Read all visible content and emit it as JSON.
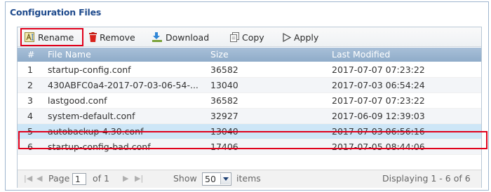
{
  "section": {
    "title": "Configuration Files"
  },
  "toolbar": {
    "rename": "Rename",
    "remove": "Remove",
    "download": "Download",
    "copy": "Copy",
    "apply": "Apply"
  },
  "columns": {
    "num": "#",
    "name": "File Name",
    "size": "Size",
    "modified": "Last Modified"
  },
  "rows": [
    {
      "num": "1",
      "name": "startup-config.conf",
      "size": "36582",
      "modified": "2017-07-07 07:23:22"
    },
    {
      "num": "2",
      "name": "430ABFC0a4-2017-07-03-06-54-...",
      "size": "13040",
      "modified": "2017-07-03 06:54:24"
    },
    {
      "num": "3",
      "name": "lastgood.conf",
      "size": "36582",
      "modified": "2017-07-07 07:23:22"
    },
    {
      "num": "4",
      "name": "system-default.conf",
      "size": "32927",
      "modified": "2017-06-09 12:39:03"
    },
    {
      "num": "5",
      "name": "autobackup-4.30.conf",
      "size": "13040",
      "modified": "2017-07-03 06:56:16"
    },
    {
      "num": "6",
      "name": "startup-config-bad.conf",
      "size": "17406",
      "modified": "2017-07-05 08:44:06"
    }
  ],
  "pager": {
    "page_label": "Page",
    "page_value": "1",
    "of_label": "of 1",
    "show_label": "Show",
    "page_size": "50",
    "items_label": "items",
    "displaying": "Displaying 1 - 6 of 6"
  },
  "colors": {
    "title": "#1e4a8c",
    "header": "#9bb6d2",
    "selected_row": "#cde6f7",
    "highlight": "#e0001b",
    "remove_icon": "#d9221c"
  },
  "icons": {
    "rename": "rename-icon",
    "remove": "trash-icon",
    "download": "download-icon",
    "copy": "copy-icon",
    "apply": "play-outline-icon"
  }
}
